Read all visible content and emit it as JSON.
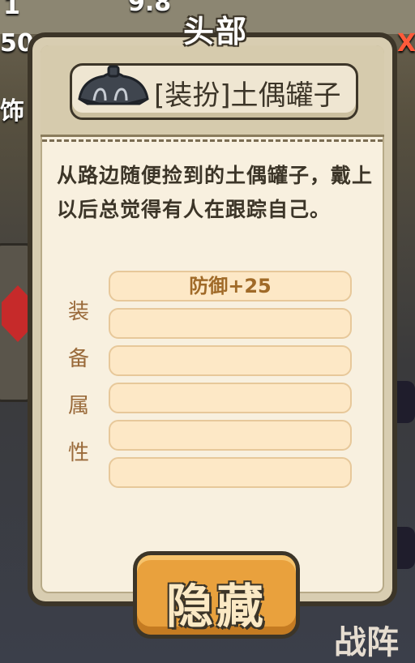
{
  "background": {
    "top_left_number": "1",
    "top_number": "9.8",
    "left_number": "50",
    "left_side_text": "饰",
    "bottom_right_text": "战阵",
    "right_text": "X"
  },
  "panel": {
    "title": "头部",
    "item_name": "[装扮]土偶罐子",
    "item_icon": "clay-pot-helmet-icon",
    "description": "从路边随便捡到的土偶罐子，戴上以后总觉得有人在跟踪自己。",
    "attributes_label": [
      "装",
      "备",
      "属",
      "性"
    ],
    "attributes": [
      "防御+25",
      "",
      "",
      "",
      "",
      ""
    ],
    "hide_button": "隐藏"
  },
  "colors": {
    "panel_bg": "#f8f0df",
    "frame": "#3c3528",
    "attr_bg": "#fde8c6",
    "attr_text": "#a06a28",
    "button": "#e9a13d"
  }
}
